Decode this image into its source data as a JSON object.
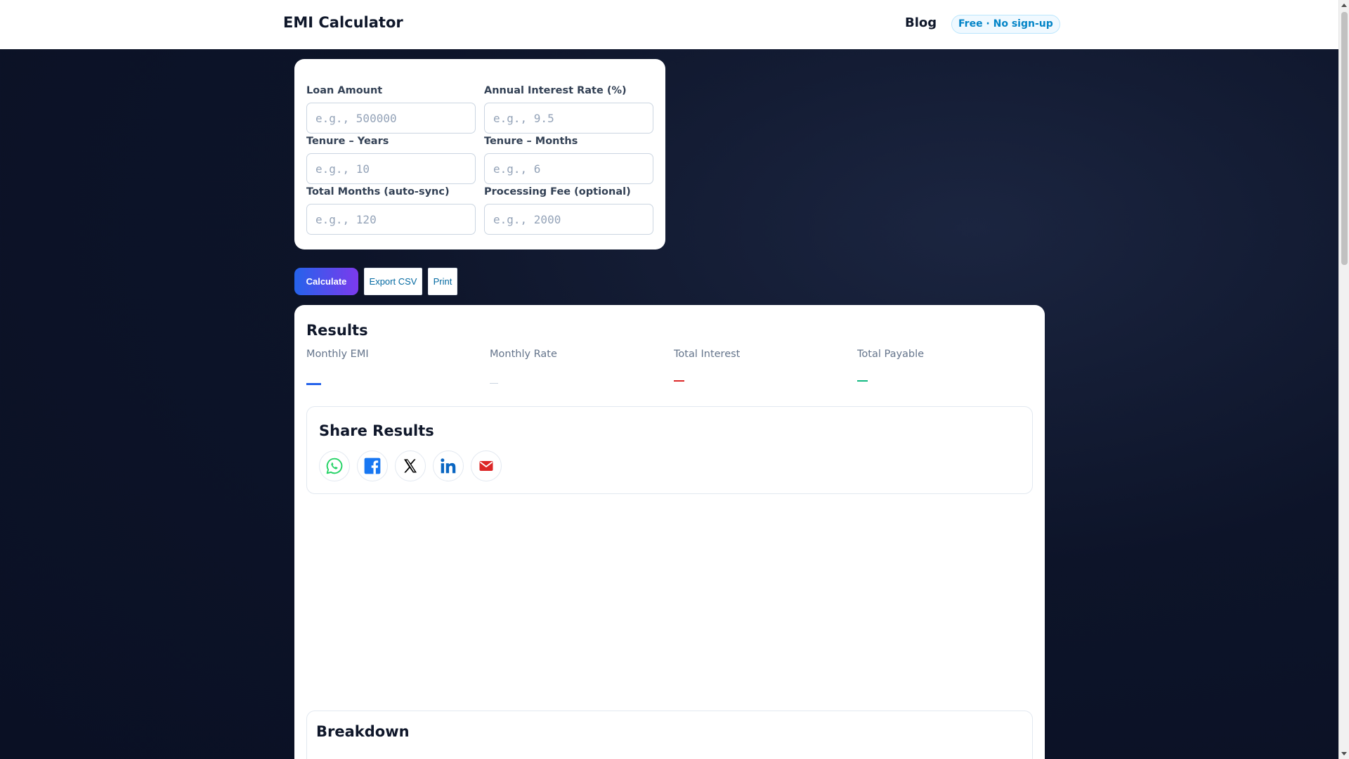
{
  "header": {
    "brand": "EMI Calculator",
    "nav_blog": "Blog",
    "badge": "Free · No sign-up"
  },
  "form": {
    "fields": [
      {
        "label": "Loan Amount",
        "placeholder": "e.g., 500000",
        "value": ""
      },
      {
        "label": "Annual Interest Rate (%)",
        "placeholder": "e.g., 9.5",
        "value": ""
      },
      {
        "label": "Tenure – Years",
        "placeholder": "e.g., 10",
        "value": ""
      },
      {
        "label": "Tenure – Months",
        "placeholder": "e.g., 6",
        "value": ""
      },
      {
        "label": "Total Months (auto-sync)",
        "placeholder": "e.g., 120",
        "value": ""
      },
      {
        "label": "Processing Fee (optional)",
        "placeholder": "e.g., 2000",
        "value": ""
      }
    ]
  },
  "actions": {
    "calculate": "Calculate",
    "export_csv": "Export CSV",
    "print": "Print"
  },
  "results": {
    "title": "Results",
    "stats": [
      {
        "label": "Monthly EMI",
        "value": "—",
        "color": "#2563eb"
      },
      {
        "label": "Monthly Rate",
        "value": "—",
        "color": "#cbd5e1"
      },
      {
        "label": "Total Interest",
        "value": "—",
        "color": "#dc2626"
      },
      {
        "label": "Total Payable",
        "value": "—",
        "color": "#10b981"
      }
    ]
  },
  "share": {
    "title": "Share Results",
    "buttons": [
      {
        "name": "whatsapp-icon",
        "color": "#25d366"
      },
      {
        "name": "facebook-icon",
        "color": "#1877f2"
      },
      {
        "name": "x-icon",
        "color": "#000000"
      },
      {
        "name": "linkedin-icon",
        "color": "#0a66c2"
      },
      {
        "name": "email-icon",
        "color": "#dc2626"
      }
    ]
  },
  "breakdown": {
    "title": "Breakdown"
  }
}
